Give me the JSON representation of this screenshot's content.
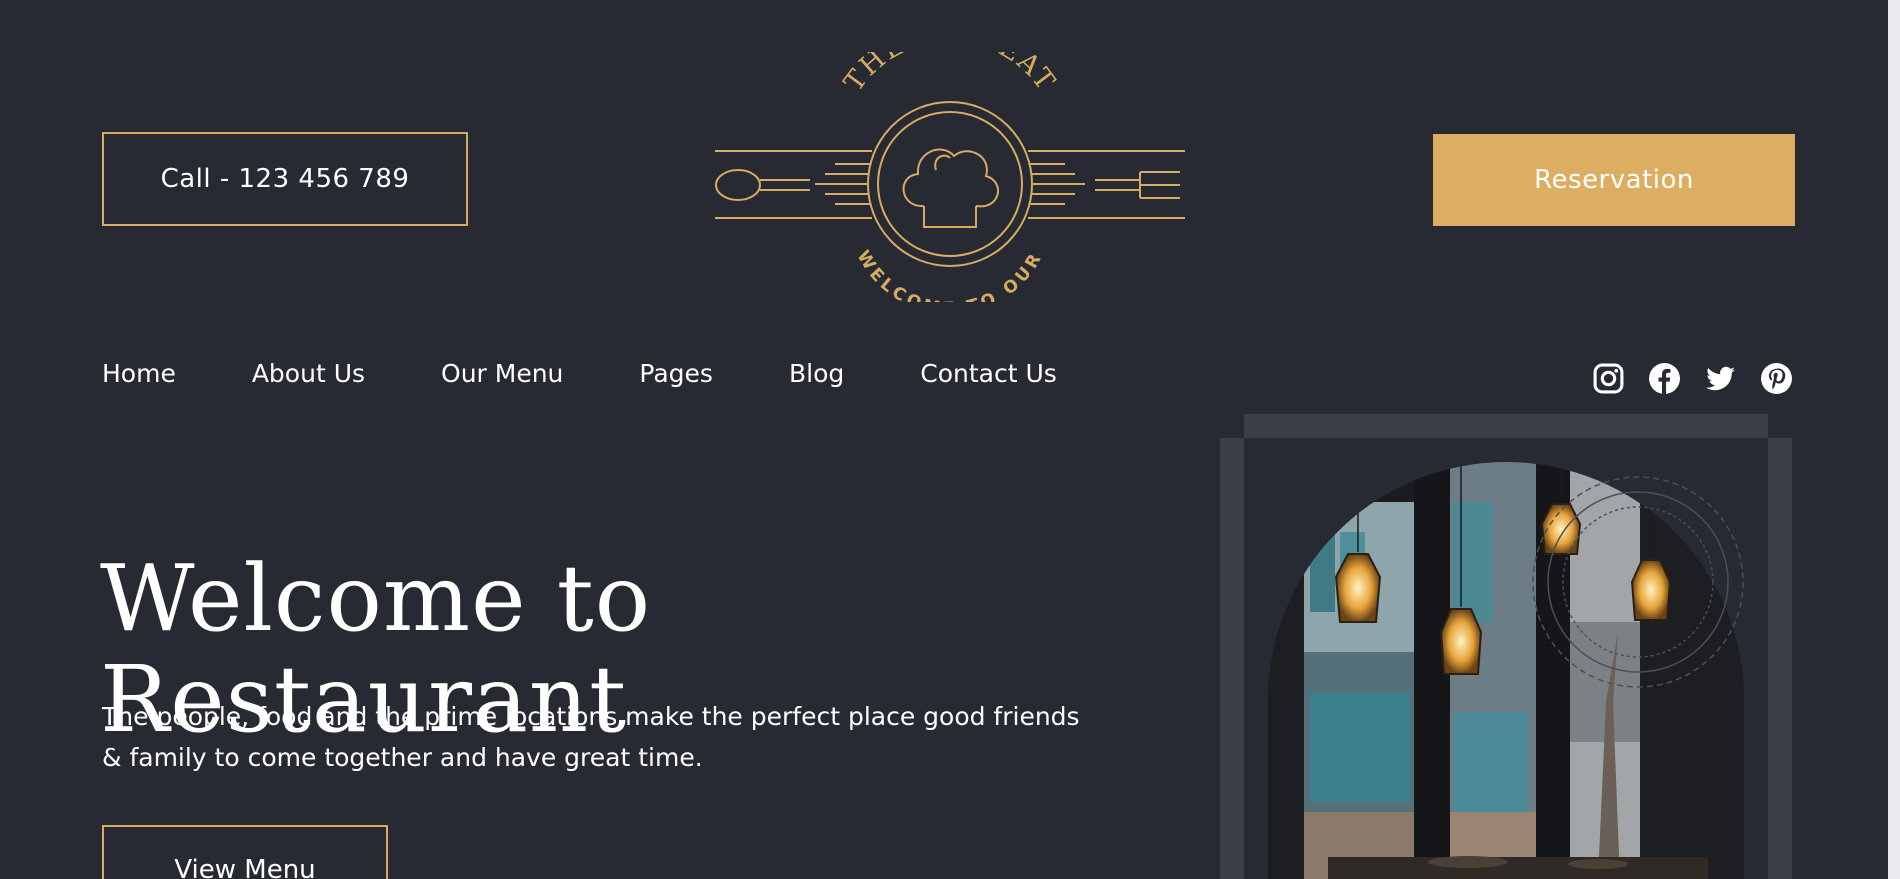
{
  "header": {
    "call_label": "Call - 123 456 789",
    "reservation_label": "Reservation",
    "logo": {
      "top_text": "THE TASTEAT",
      "bottom_text": "WELCOME TO OUR"
    }
  },
  "nav": {
    "items": [
      {
        "label": "Home"
      },
      {
        "label": "About Us"
      },
      {
        "label": "Our Menu"
      },
      {
        "label": "Pages"
      },
      {
        "label": "Blog"
      },
      {
        "label": "Contact Us"
      }
    ]
  },
  "social": [
    "instagram-icon",
    "facebook-icon",
    "twitter-icon",
    "pinterest-icon"
  ],
  "hero": {
    "title": "Welcome to Restaurant",
    "description": "The people, food and the prime locations make the perfect place good friends & family to come together and have great time.",
    "button_label": "View Menu"
  },
  "colors": {
    "background": "#272a33",
    "accent": "#ddad61",
    "frame": "#3b3e47"
  }
}
